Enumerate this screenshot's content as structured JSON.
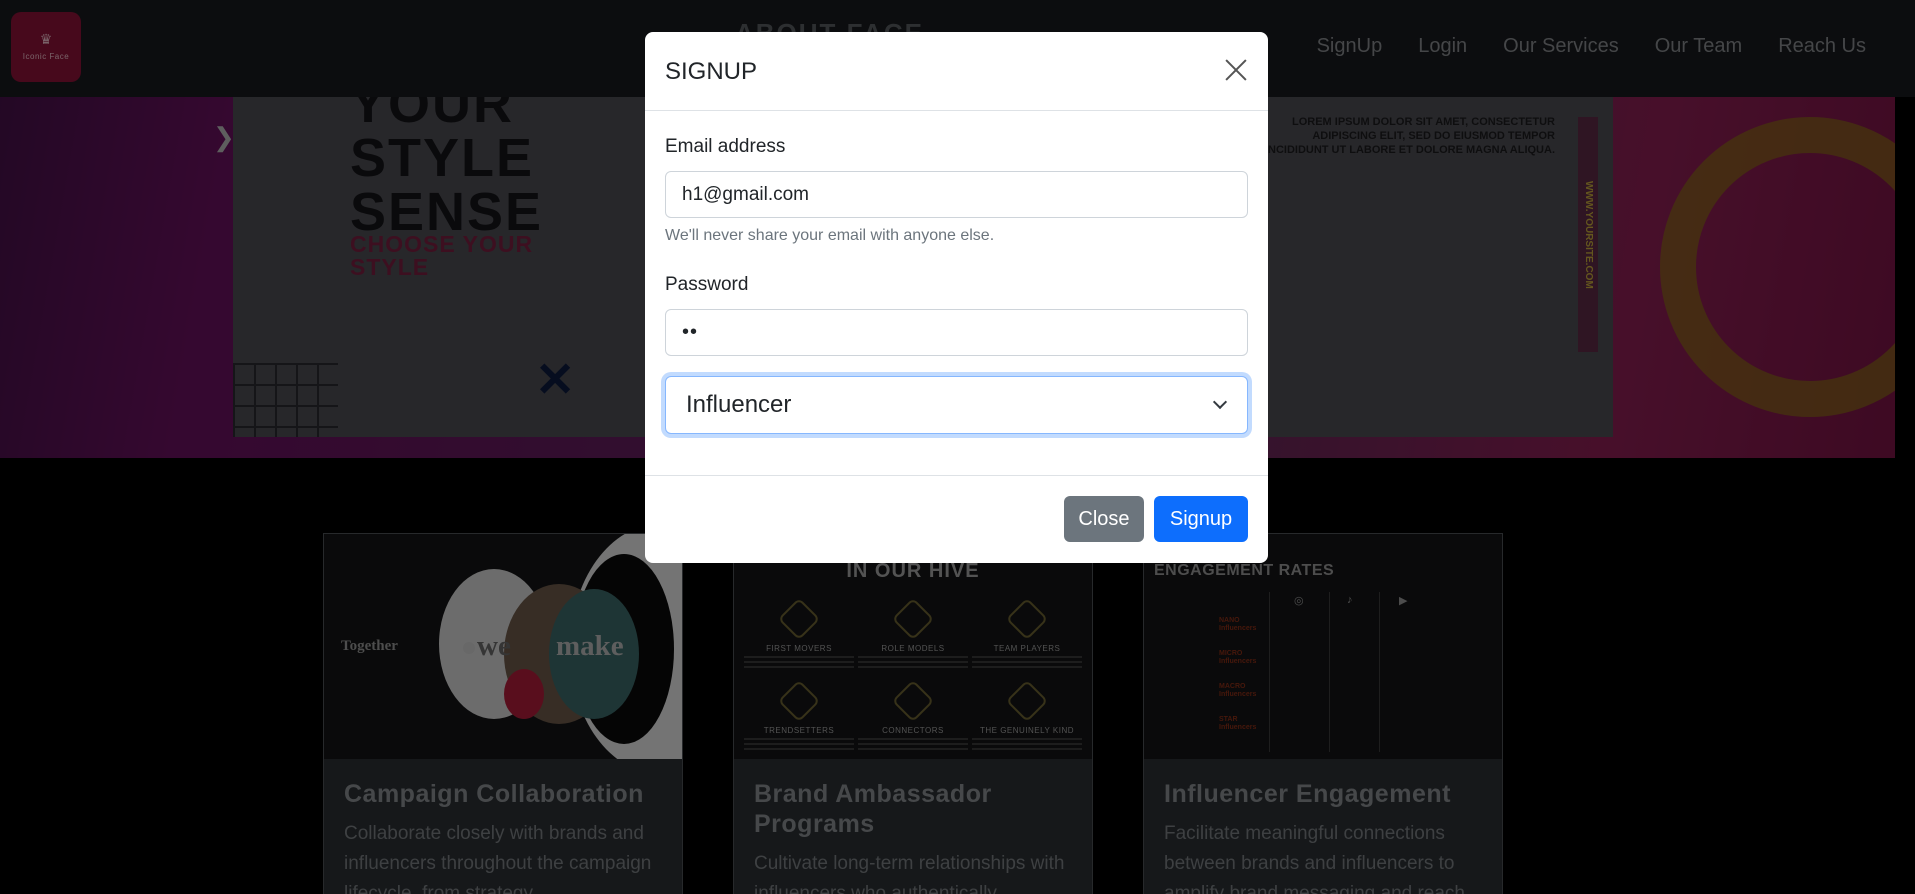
{
  "navbar": {
    "logo_text": "Iconic Face",
    "center_text": "ABOUT FACE",
    "links": [
      "SignUp",
      "Login",
      "Our Services",
      "Our Team",
      "Reach Us"
    ]
  },
  "hero": {
    "headline_lines": [
      "YOUR",
      "STYLE",
      "SENSE"
    ],
    "subline_lines": [
      "CHOOSE YOUR",
      "STYLE"
    ],
    "small_text": "LOREM IPSUM DOLOR SIT AMET, CONSECTETUR ADIPISCING ELIT, SED DO EIUSMOD TEMPOR INCIDIDUNT UT LABORE ET DOLORE MAGNA ALIQUA.",
    "vertical_text": "WWW.YOURSITE.COM"
  },
  "cards": [
    {
      "title": "Campaign Collaboration",
      "text": "Collaborate closely with brands and influencers throughout the campaign lifecycle, from strategy",
      "image_words": [
        "Together",
        "we",
        "make"
      ]
    },
    {
      "title": "Brand Ambassador Programs",
      "text": "Cultivate long-term relationships with influencers who authentically",
      "image_title": "IN OUR HIVE",
      "image_labels": [
        "FIRST MOVERS",
        "ROLE MODELS",
        "TEAM PLAYERS",
        "TRENDSETTERS",
        "CONNECTORS",
        "THE GENUINELY KIND"
      ]
    },
    {
      "title": "Influencer Engagement",
      "text": "Facilitate meaningful connections between brands and influencers to amplify brand messaging and reach",
      "image_title": "ENGAGEMENT RATES",
      "image_tiers": [
        "NANO Influencers",
        "MICRO Influencers",
        "MACRO Influencers",
        "STAR Influencers"
      ]
    }
  ],
  "modal": {
    "title": "SIGNUP",
    "email_label": "Email address",
    "email_value": "h1@gmail.com",
    "email_hint": "We'll never share your email with anyone else.",
    "password_label": "Password",
    "password_value": "••",
    "role_selected": "Influencer",
    "close_label": "Close",
    "signup_label": "Signup"
  },
  "colors": {
    "primary": "#0d6efd",
    "secondary": "#6c757d",
    "navbar_bg": "#181b1f",
    "card_bg": "#2c3135",
    "logo_bg": "#8e1238"
  },
  "icons": [
    "close-icon",
    "chevron-down-icon",
    "instagram-icon",
    "tiktok-icon",
    "youtube-icon"
  ]
}
